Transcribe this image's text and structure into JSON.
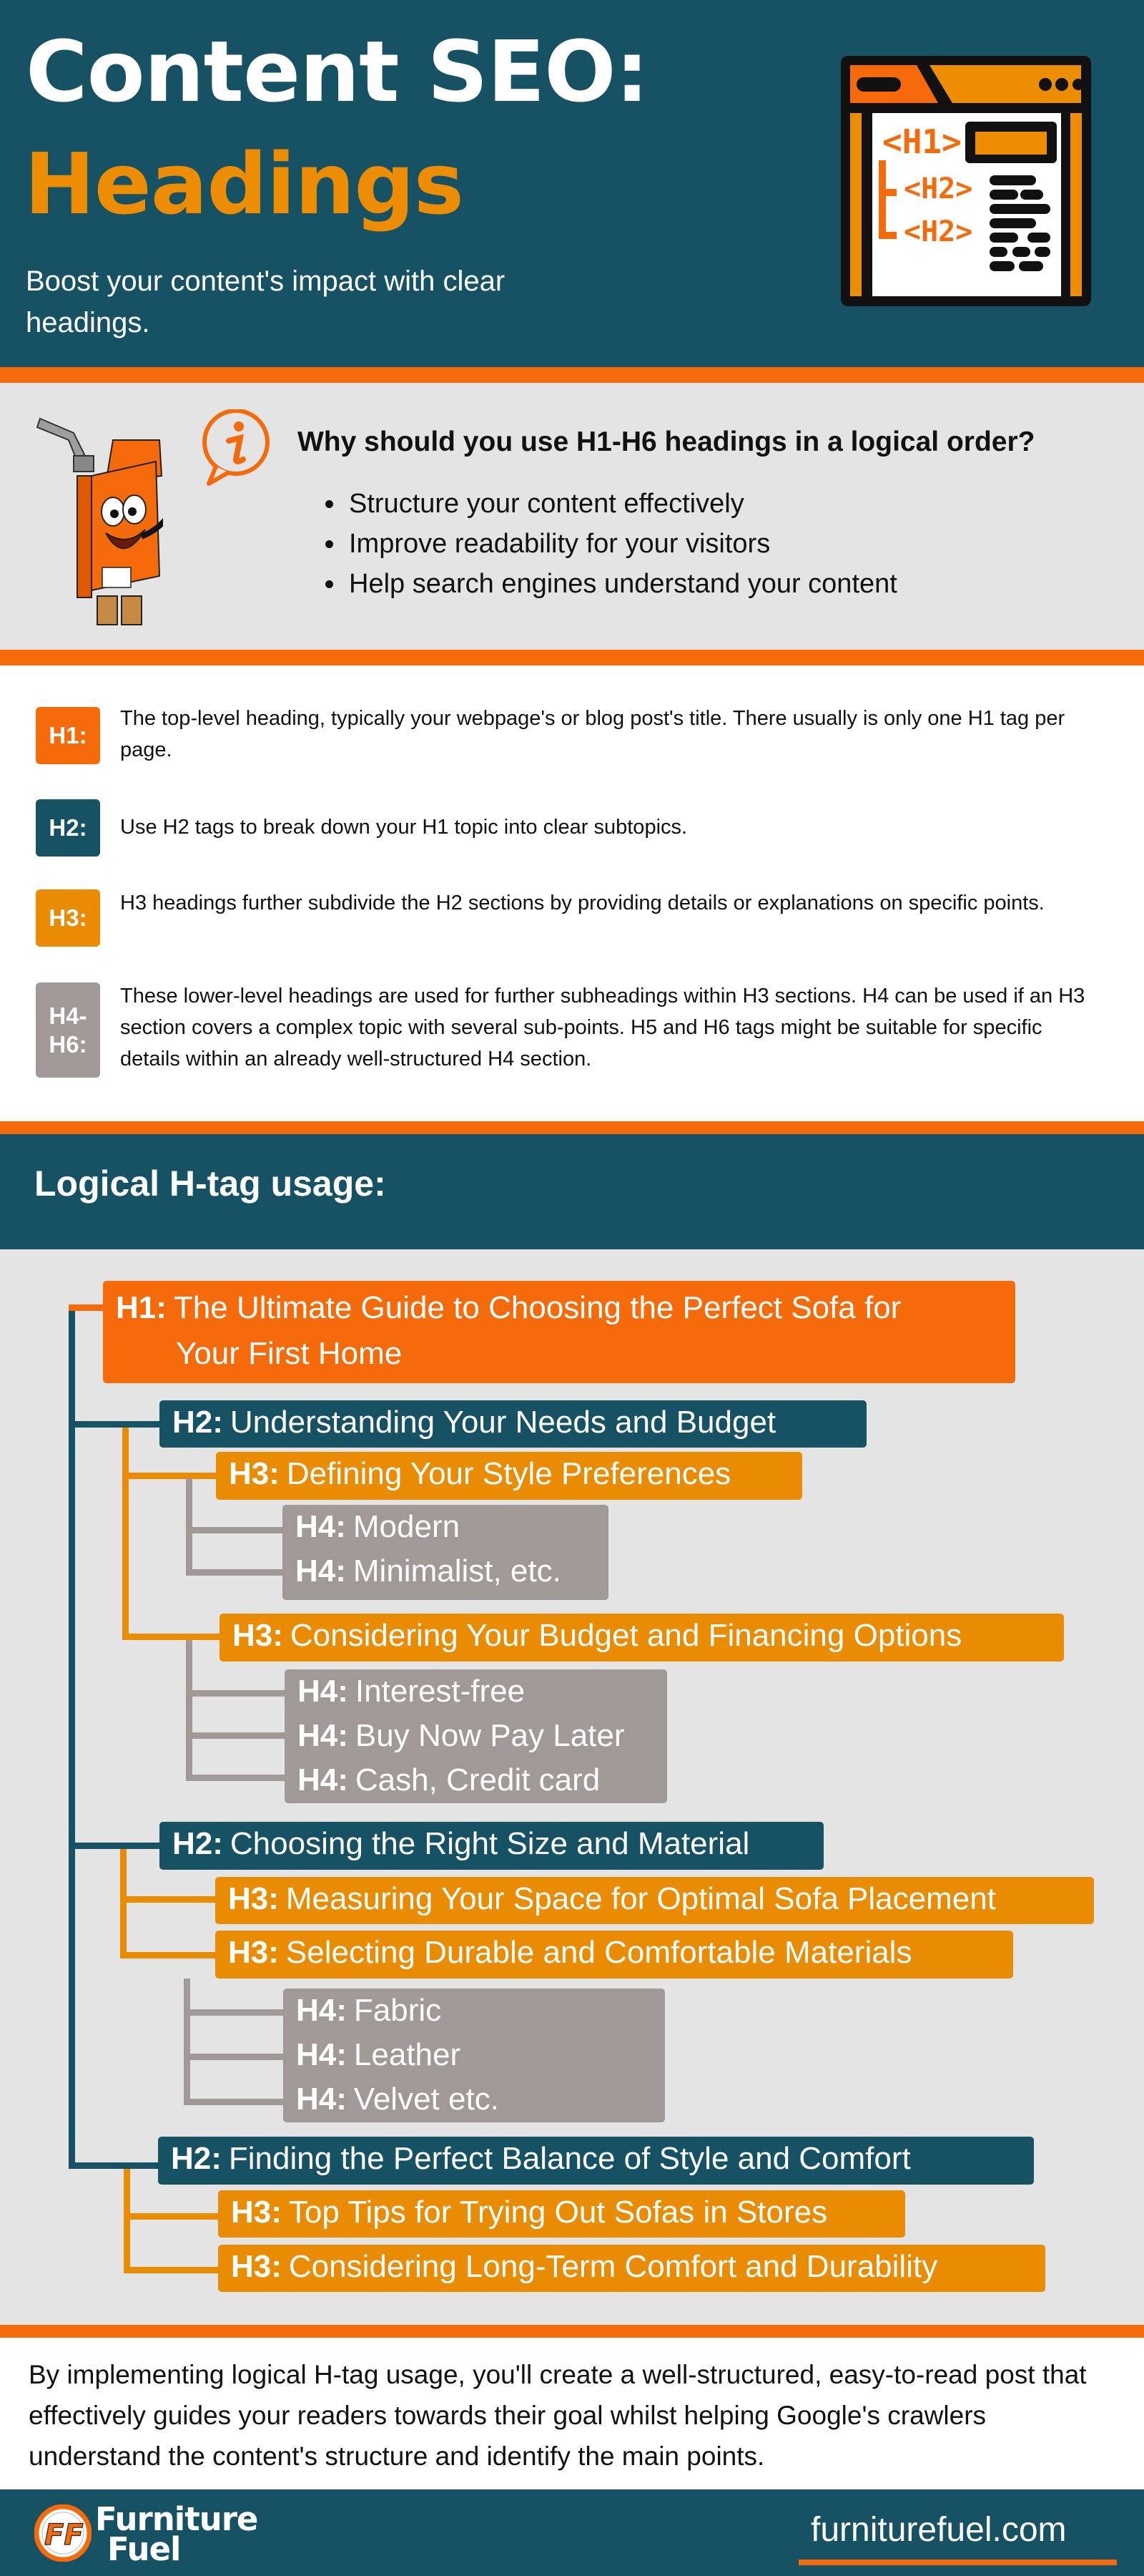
{
  "header": {
    "title_line1": "Content SEO:",
    "title_line2": "Headings",
    "subtitle": "Boost your content's impact with clear headings.",
    "icon": "browser-headings-icon",
    "icon_labels": [
      "<H1>",
      "<H2>",
      "<H2>"
    ]
  },
  "why": {
    "mascot": "fuel-can-mascot",
    "info_icon": "info-icon",
    "title": "Why should you use H1-H6 headings in a logical order?",
    "bullets": [
      "Structure your content effectively",
      "Improve readability for your visitors",
      "Help search engines understand your content"
    ]
  },
  "legend": [
    {
      "tag": "H1:",
      "color": "#f56a0a",
      "text": "The top-level heading, typically your webpage's or blog post's title. There usually is only one H1 tag per page."
    },
    {
      "tag": "H2:",
      "color": "#165264",
      "text": "Use H2 tags to break down your H1 topic into clear subtopics."
    },
    {
      "tag": "H3:",
      "color": "#e98b03",
      "text": "H3 headings further subdivide the H2 sections by providing details or explanations on specific points."
    },
    {
      "tag": "H4-H6:",
      "color": "#a19996",
      "text": "These lower-level headings are used for further subheadings within H3 sections. H4 can be used if an H3 section covers a complex topic with several sub-points. H5 and H6 tags might be suitable for specific details within an already well-structured H4 section."
    }
  ],
  "logical": {
    "title": "Logical H-tag usage:",
    "tree": {
      "h1": {
        "tag": "H1:",
        "text": "The Ultimate Guide to Choosing the Perfect Sofa for",
        "text2": "Your First Home"
      },
      "h2": [
        {
          "tag": "H2:",
          "text": "Understanding Your Needs and Budget"
        },
        {
          "tag": "H2:",
          "text": "Choosing the Right Size and Material"
        },
        {
          "tag": "H2:",
          "text": "Finding the Perfect Balance of Style and Comfort"
        }
      ],
      "h3": [
        {
          "tag": "H3:",
          "text": "Defining Your Style Preferences"
        },
        {
          "tag": "H3:",
          "text": "Considering Your Budget and Financing Options"
        },
        {
          "tag": "H3:",
          "text": "Measuring Your Space for Optimal Sofa Placement"
        },
        {
          "tag": "H3:",
          "text": "Selecting Durable and Comfortable Materials"
        },
        {
          "tag": "H3:",
          "text": "Top Tips for Trying Out Sofas in Stores"
        },
        {
          "tag": "H3:",
          "text": "Considering Long-Term Comfort and Durability"
        }
      ],
      "h4": [
        {
          "tag": "H4:",
          "text": "Modern"
        },
        {
          "tag": "H4:",
          "text": "Minimalist, etc."
        },
        {
          "tag": "H4:",
          "text": "Interest-free"
        },
        {
          "tag": "H4:",
          "text": "Buy Now Pay Later"
        },
        {
          "tag": "H4:",
          "text": "Cash, Credit card"
        },
        {
          "tag": "H4:",
          "text": "Fabric"
        },
        {
          "tag": "H4:",
          "text": "Leather"
        },
        {
          "tag": "H4:",
          "text": "Velvet etc."
        }
      ]
    }
  },
  "conclusion": "By implementing logical H-tag usage, you'll create a well-structured, easy-to-read post that effectively guides your readers towards their goal whilst helping Google's crawlers understand the content's structure and identify the main points.",
  "footer": {
    "logo_line1": "Furniture",
    "logo_line2": "Fuel",
    "logo_mark": "FF",
    "url": "furniturefuel.com"
  },
  "colors": {
    "teal": "#165264",
    "orange": "#f56a0a",
    "amber": "#e98b03",
    "taupe": "#a19996",
    "light_gray": "#e4e4e4"
  }
}
